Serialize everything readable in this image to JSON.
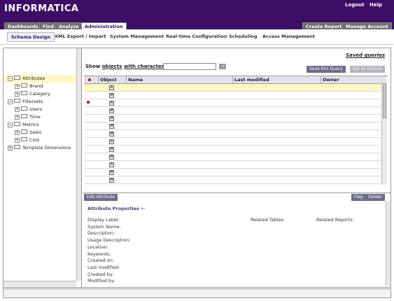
{
  "app": {
    "logo": "INFORMATICA"
  },
  "top_links": [
    "Logout",
    "Help"
  ],
  "left_tabs": [
    {
      "label": "Dashboards",
      "active": false
    },
    {
      "label": "Find",
      "active": false
    },
    {
      "label": "Analyze",
      "active": false
    },
    {
      "label": "Administration",
      "active": true
    }
  ],
  "right_tabs": [
    "Create Report",
    "Manage Account"
  ],
  "subnav": [
    {
      "label": "Schema Design",
      "active": true
    },
    {
      "label": "XML Export / Import",
      "active": false
    },
    {
      "label": "System Management",
      "active": false
    },
    {
      "label": "Real-time Configuration",
      "active": false
    },
    {
      "label": "Scheduling",
      "active": false
    },
    {
      "label": "Access Management",
      "active": false
    }
  ],
  "tree": [
    {
      "label": "Attributes",
      "expander": "−",
      "level": 0,
      "selected": true
    },
    {
      "label": "Brand",
      "expander": "+",
      "level": 1,
      "selected": false
    },
    {
      "label": "Category",
      "expander": "+",
      "level": 1,
      "selected": false
    },
    {
      "label": "Filtersets",
      "expander": "−",
      "level": 0,
      "selected": false
    },
    {
      "label": "Users",
      "expander": "+",
      "level": 1,
      "selected": false
    },
    {
      "label": "Time",
      "expander": "+",
      "level": 1,
      "selected": false
    },
    {
      "label": "Metrics",
      "expander": "−",
      "level": 0,
      "selected": false
    },
    {
      "label": "Sales",
      "expander": "+",
      "level": 1,
      "selected": false
    },
    {
      "label": "Cost",
      "expander": "+",
      "level": 1,
      "selected": false
    },
    {
      "label": "Template Dimensions",
      "expander": "+",
      "level": 0,
      "selected": false
    }
  ],
  "query": {
    "saved_queries": "Saved queries",
    "show": "Show",
    "objects": "objects",
    "with_characters": "with characters",
    "search_value": "",
    "go": "→",
    "save_this_query": "Save this Query",
    "set_as_default": "Set as Default"
  },
  "grid": {
    "columns": [
      "",
      "Object",
      "Name",
      "Last modified",
      "Owner"
    ],
    "rows": [
      {
        "flag": false,
        "type": "A",
        "selected": true
      },
      {
        "flag": false,
        "type": "M",
        "selected": false
      },
      {
        "flag": true,
        "type": "A",
        "selected": false
      },
      {
        "flag": false,
        "type": "M",
        "selected": false
      },
      {
        "flag": false,
        "type": "M",
        "selected": false
      },
      {
        "flag": false,
        "type": "M",
        "selected": false
      },
      {
        "flag": false,
        "type": "M",
        "selected": false
      },
      {
        "flag": false,
        "type": "A",
        "selected": false
      },
      {
        "flag": false,
        "type": "M",
        "selected": false
      },
      {
        "flag": false,
        "type": "M",
        "selected": false
      },
      {
        "flag": false,
        "type": "A",
        "selected": false
      },
      {
        "flag": false,
        "type": "M",
        "selected": false
      },
      {
        "flag": false,
        "type": "M",
        "selected": false
      }
    ]
  },
  "lower": {
    "edit_attribute": "Edit Attribute",
    "flag": "Flag",
    "delete": "Delete",
    "title": "Attribute Properties",
    "properties": [
      "Display Label:",
      "System Name:",
      "Description:",
      "Usage Description:",
      "Location:",
      "Keywords:",
      "Created on:",
      "Last modified:",
      "Created by:",
      "Modified by:"
    ],
    "related_tables": "Related Tables:",
    "related_reports": "Related Reports:"
  },
  "colors": {
    "header": "#3b0d64",
    "selection": "#fff7c2",
    "button": "#6b6b8a"
  }
}
